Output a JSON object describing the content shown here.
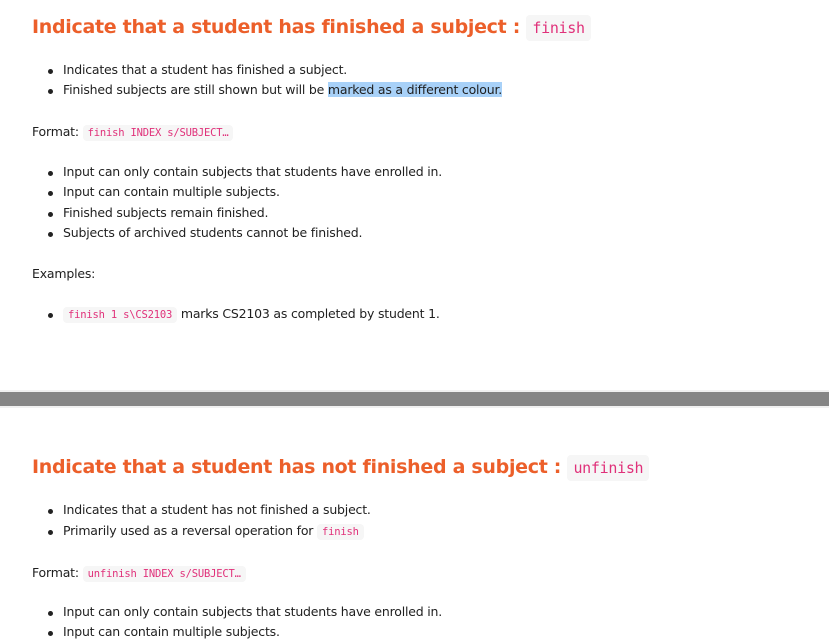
{
  "sections": [
    {
      "title": "Indicate that a student has finished a subject :",
      "command": "finish",
      "bullets": [
        "Indicates that a student has finished a subject.",
        "Finished subjects are still shown but will be ",
        "marked as a different colour."
      ],
      "format_label": "Format:",
      "format": "finish INDEX s/SUBJECT…",
      "rules": [
        "Input can only contain subjects that students have enrolled in.",
        "Input can contain multiple subjects.",
        "Finished subjects remain finished.",
        "Subjects of archived students cannot be finished."
      ],
      "examples_label": "Examples:",
      "example_code": "finish 1 s\\CS2103",
      "example_text": "marks CS2103 as completed by student 1."
    },
    {
      "title": "Indicate that a student has not finished a subject :",
      "command": "unfinish",
      "bullets": [
        "Indicates that a student has not finished a subject.",
        "Primarily used as a reversal operation for"
      ],
      "bullet_code": "finish",
      "format_label": "Format:",
      "format": "unfinish INDEX s/SUBJECT…",
      "rules": [
        "Input can only contain subjects that students have enrolled in.",
        "Input can contain multiple subjects."
      ]
    }
  ]
}
